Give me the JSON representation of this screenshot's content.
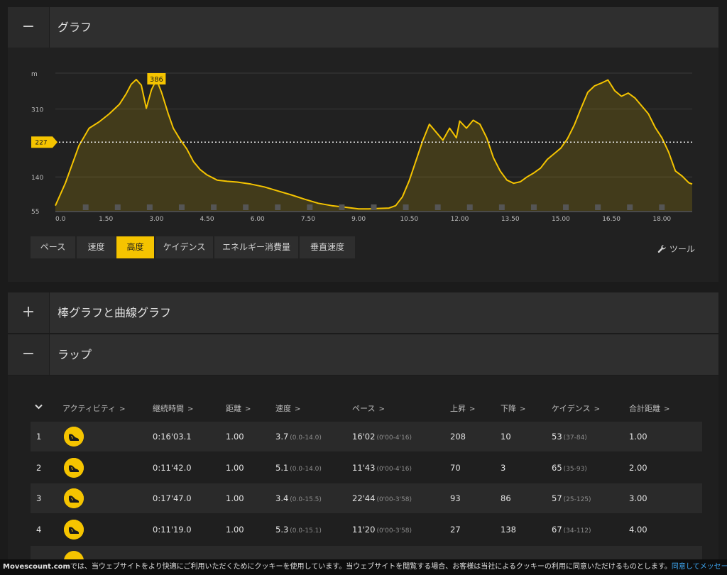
{
  "panels": {
    "graph": {
      "toggle": "−",
      "title": "グラフ"
    },
    "bars": {
      "toggle": "+",
      "title": "棒グラフと曲線グラフ"
    },
    "laps": {
      "toggle": "−",
      "title": "ラップ"
    }
  },
  "tabs": [
    {
      "label": "ペース",
      "active": false
    },
    {
      "label": "速度",
      "active": false
    },
    {
      "label": "高度",
      "active": true
    },
    {
      "label": "ケイデンス",
      "active": false
    },
    {
      "label": "エネルギー消費量",
      "active": false
    },
    {
      "label": "垂直速度",
      "active": false
    }
  ],
  "tools": {
    "icon": "wrench-icon",
    "label": "ツール"
  },
  "chart_data": {
    "type": "area",
    "unit": "m",
    "accent": "#f5c400",
    "ylim": [
      55,
      400
    ],
    "xlim": [
      0,
      18.9
    ],
    "y_ticks": [
      310,
      140,
      55
    ],
    "x_ticks": [
      "0.0",
      "1.50",
      "3.00",
      "4.50",
      "6.00",
      "7.50",
      "9.00",
      "10.50",
      "12.00",
      "13.50",
      "15.00",
      "16.50",
      "18.00"
    ],
    "avg_label": "227",
    "avg_value": 227,
    "peak_label": "386",
    "peak_x": 3.0,
    "x": [
      0.0,
      0.3,
      0.7,
      1.0,
      1.3,
      1.6,
      1.9,
      2.1,
      2.25,
      2.4,
      2.55,
      2.7,
      2.85,
      3.0,
      3.15,
      3.35,
      3.5,
      3.7,
      3.9,
      4.1,
      4.3,
      4.5,
      4.8,
      5.1,
      5.4,
      5.8,
      6.2,
      6.6,
      7.0,
      7.4,
      7.8,
      8.2,
      8.6,
      9.0,
      9.3,
      9.6,
      9.9,
      10.1,
      10.3,
      10.5,
      10.7,
      10.9,
      11.1,
      11.3,
      11.5,
      11.7,
      11.9,
      12.0,
      12.2,
      12.4,
      12.6,
      12.8,
      13.0,
      13.2,
      13.4,
      13.6,
      13.8,
      14.0,
      14.2,
      14.4,
      14.6,
      14.8,
      15.0,
      15.2,
      15.4,
      15.6,
      15.8,
      16.0,
      16.2,
      16.4,
      16.6,
      16.8,
      17.0,
      17.2,
      17.4,
      17.6,
      17.8,
      18.0,
      18.2,
      18.4,
      18.6,
      18.8,
      18.9
    ],
    "y": [
      68,
      125,
      218,
      262,
      278,
      298,
      322,
      348,
      372,
      384,
      370,
      312,
      358,
      384,
      352,
      298,
      262,
      234,
      210,
      178,
      158,
      145,
      132,
      129,
      127,
      122,
      115,
      105,
      95,
      84,
      74,
      68,
      64,
      60,
      60,
      61,
      62,
      68,
      90,
      130,
      180,
      230,
      272,
      252,
      232,
      262,
      238,
      280,
      262,
      282,
      272,
      238,
      188,
      155,
      132,
      124,
      128,
      140,
      150,
      162,
      184,
      198,
      212,
      236,
      270,
      312,
      352,
      368,
      375,
      383,
      356,
      342,
      350,
      338,
      318,
      298,
      264,
      238,
      202,
      155,
      142,
      125,
      122
    ]
  },
  "table": {
    "sort_icon": "chevron-down-icon",
    "columns": [
      "アクティビティ",
      "継続時間",
      "距離",
      "速度",
      "ペース",
      "上昇",
      "下降",
      "ケイデンス",
      "合計距離"
    ],
    "rows": [
      {
        "num": "1",
        "duration": "0:16'03.1",
        "distance": "1.00",
        "speed": "3.7",
        "speed_range": "(0.0-14.0)",
        "pace": "16'02",
        "pace_range": "(0'00-4'16)",
        "ascent": "208",
        "descent": "10",
        "cadence": "53",
        "cadence_range": "(37-84)",
        "total": "1.00"
      },
      {
        "num": "2",
        "duration": "0:11'42.0",
        "distance": "1.00",
        "speed": "5.1",
        "speed_range": "(0.0-14.0)",
        "pace": "11'43",
        "pace_range": "(0'00-4'16)",
        "ascent": "70",
        "descent": "3",
        "cadence": "65",
        "cadence_range": "(35-93)",
        "total": "2.00"
      },
      {
        "num": "3",
        "duration": "0:17'47.0",
        "distance": "1.00",
        "speed": "3.4",
        "speed_range": "(0.0-15.5)",
        "pace": "22'44",
        "pace_range": "(0'00-3'58)",
        "ascent": "93",
        "descent": "86",
        "cadence": "57",
        "cadence_range": "(25-125)",
        "total": "3.00"
      },
      {
        "num": "4",
        "duration": "0:11'19.0",
        "distance": "1.00",
        "speed": "5.3",
        "speed_range": "(0.0-15.1)",
        "pace": "11'20",
        "pace_range": "(0'00-3'58)",
        "ascent": "27",
        "descent": "138",
        "cadence": "67",
        "cadence_range": "(34-112)",
        "total": "4.00"
      }
    ]
  },
  "footer": {
    "brand": "Movescount.com",
    "text": "では、当ウェブサイトをより快適にご利用いただくためにクッキーを使用しています。当ウェブサイトを閲覧する場合、お客様は当社によるクッキーの利用に同意いただけるものとします。",
    "link": "同意してメッセージを閉じる。"
  }
}
